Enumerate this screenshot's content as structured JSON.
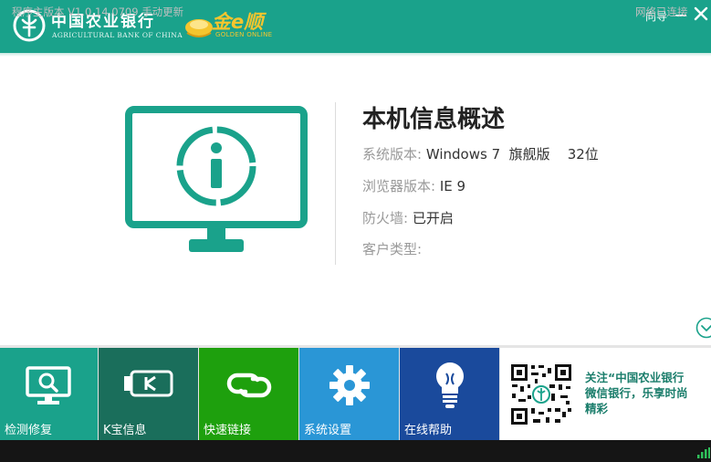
{
  "header": {
    "bank_name_cn": "中国农业银行",
    "bank_name_en": "AGRICULTURAL BANK OF CHINA",
    "product_name_cn": "金e顺",
    "product_name_en": "GOLDEN ONLINE",
    "wizard_label": "向导",
    "minimize_icon": "minimize-icon",
    "close_icon": "close-icon"
  },
  "info": {
    "title": "本机信息概述",
    "os_label": "系统版本:",
    "os_value": "Windows 7  旗舰版    32位",
    "browser_label": "浏览器版本:",
    "browser_value": "IE 9",
    "firewall_label": "防火墙:",
    "firewall_value": "已开启",
    "customer_type_label": "客户类型:",
    "customer_type_value": ""
  },
  "tiles": [
    {
      "label": "检测修复",
      "icon": "monitor-search-icon",
      "color": "#1aa28b"
    },
    {
      "label": "K宝信息",
      "icon": "usb-key-icon",
      "color": "#1a6e5b"
    },
    {
      "label": "快速链接",
      "icon": "link-icon",
      "color": "#1ea00d"
    },
    {
      "label": "系统设置",
      "icon": "gear-icon",
      "color": "#2a96d6"
    },
    {
      "label": "在线帮助",
      "icon": "lightbulb-icon",
      "color": "#1a4a9c"
    }
  ],
  "promo": {
    "line1": "关注“中国农业银行",
    "line2": "微信银行，乐享时尚",
    "line3": "精彩"
  },
  "status": {
    "version_label": "程序主版本 V1.0.14.0709",
    "update_link": "手动更新",
    "network_status": "网络已连接"
  },
  "colors": {
    "brand_green": "#1aa28b",
    "gold": "#f5c52e"
  }
}
